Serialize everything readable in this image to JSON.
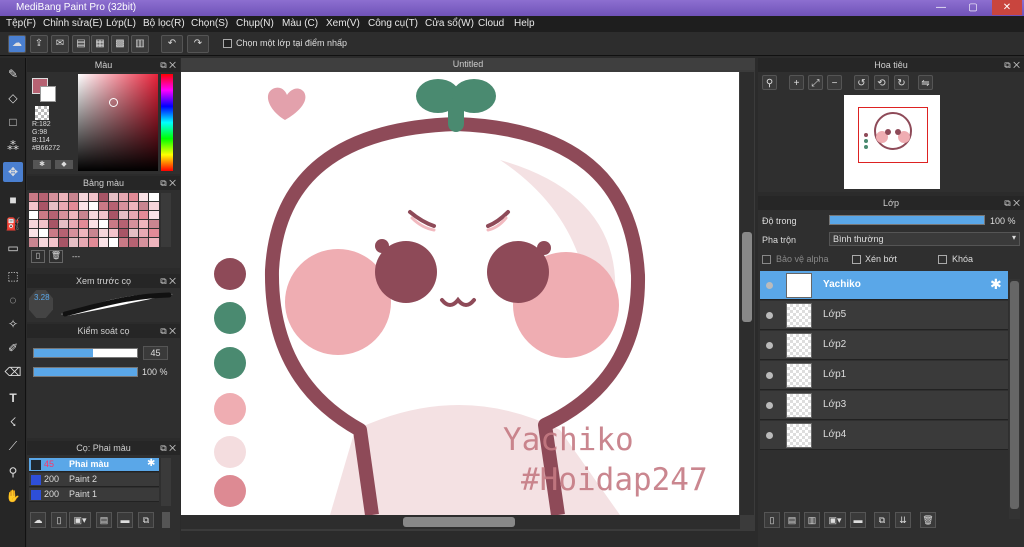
{
  "window": {
    "title": "MediBang Paint Pro (32bit)",
    "min": "—",
    "max": "▢",
    "close": "✕"
  },
  "menu": [
    "Tệp(F)",
    "Chỉnh sửa(E)",
    "Lớp(L)",
    "Bộ lọc(R)",
    "Chọn(S)",
    "Chụp(N)",
    "Màu (C)",
    "Xem(V)",
    "Công cụ(T)",
    "Cửa sổ(W)",
    "Cloud",
    "Help"
  ],
  "toolbar": {
    "checkbox_label": "Chọn một lớp tại điểm nhấp"
  },
  "color_panel": {
    "title": "Màu",
    "r": "R:182",
    "g": "G:98",
    "b": "B:114",
    "hex": "#B66272",
    "primary": "#b66272"
  },
  "palette_panel": {
    "title": "Bảng màu",
    "ellipsis": "---"
  },
  "brush_preview": {
    "title": "Xem trước cọ",
    "size": "3.28"
  },
  "brush_control": {
    "title": "Kiểm soát cọ",
    "size_value": "45",
    "opacity_value": "100 %",
    "size_fraction": 0.57,
    "opacity_fraction": 1.0
  },
  "brush_list": {
    "title": "Cọ: Phai màu",
    "items": [
      {
        "size": "45",
        "name": "Phai màu",
        "selected": true,
        "color": "#202830"
      },
      {
        "size": "200",
        "name": "Paint 2",
        "selected": false,
        "color": "#2e4fd8"
      },
      {
        "size": "200",
        "name": "Paint 1",
        "selected": false,
        "color": "#2e4fd8"
      }
    ]
  },
  "canvas": {
    "tab": "Untitled",
    "watermark_line1": "Yachiko",
    "watermark_line2": "#Hoidap247"
  },
  "navigator": {
    "title": "Hoa tiêu"
  },
  "layers": {
    "title": "Lớp",
    "opacity_label": "Độ trong",
    "opacity_value": "100 %",
    "opacity_fraction": 1.0,
    "blend_label": "Pha trộn",
    "blend_value": "Bình thường",
    "protect_alpha": "Bảo vệ alpha",
    "clipping": "Xén bớt",
    "lock": "Khóa",
    "items": [
      {
        "name": "Yachiko",
        "selected": true
      },
      {
        "name": "Lớp5",
        "selected": false
      },
      {
        "name": "Lớp2",
        "selected": false
      },
      {
        "name": "Lớp1",
        "selected": false
      },
      {
        "name": "Lớp3",
        "selected": false
      },
      {
        "name": "Lớp4",
        "selected": false
      }
    ]
  }
}
